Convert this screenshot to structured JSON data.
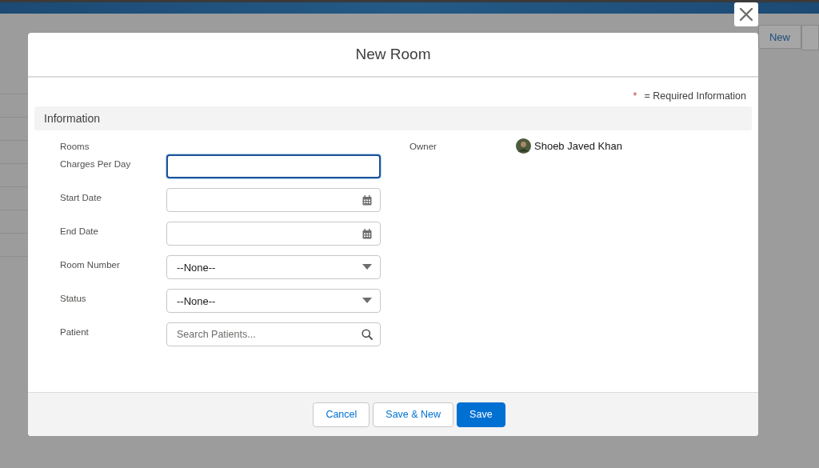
{
  "window": {
    "title": "New Room"
  },
  "background": {
    "buttons": [
      "New"
    ]
  },
  "required_note": {
    "mark": "*",
    "text": "= Required Information"
  },
  "section": {
    "title": "Information"
  },
  "fields": [
    {
      "label": "Rooms",
      "kind": "readonly"
    },
    {
      "label": "Charges Per Day",
      "kind": "text",
      "focused": true
    },
    {
      "label": "Start Date",
      "kind": "date",
      "focused": false
    },
    {
      "label": "End Date",
      "kind": "date",
      "focused": false
    },
    {
      "label": "Room Number",
      "kind": "picklist",
      "value": "--None--",
      "focused": false
    },
    {
      "label": "Status",
      "kind": "picklist",
      "value": "--None--",
      "focused": false
    },
    {
      "label": "Patient",
      "kind": "lookup",
      "placeholder": "Search Patients...",
      "focused": false
    }
  ],
  "owner": {
    "label": "Owner",
    "value": "Shoeb Javed Khan"
  },
  "buttons": [
    {
      "label": "Cancel",
      "kind": "neutral"
    },
    {
      "label": "Save & New",
      "kind": "neutral"
    },
    {
      "label": "Save",
      "kind": "brand"
    }
  ]
}
